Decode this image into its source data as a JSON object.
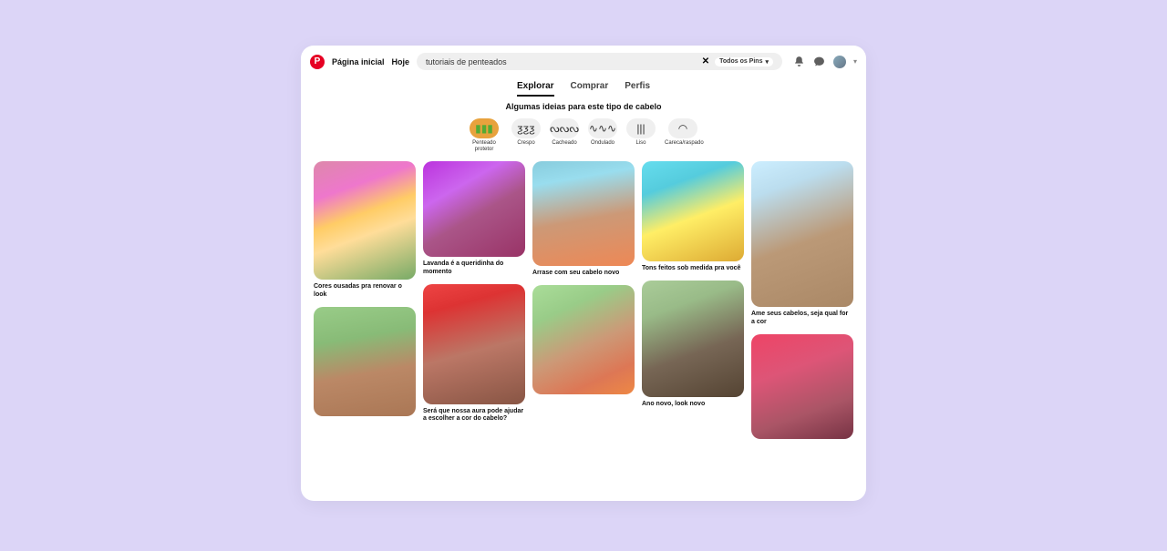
{
  "header": {
    "nav_home": "Página inicial",
    "nav_today": "Hoje",
    "search_value": "tutoriais de penteados",
    "search_pill": "Todos os Pins",
    "clear": "✕"
  },
  "tabs": [
    {
      "label": "Explorar",
      "active": true
    },
    {
      "label": "Comprar",
      "active": false
    },
    {
      "label": "Perfis",
      "active": false
    }
  ],
  "subtitle": "Algumas ideias para este tipo de cabelo",
  "filters": [
    {
      "label": "Penteado protetor",
      "glyph": "▮▮▮",
      "active": true
    },
    {
      "label": "Crespo",
      "glyph": "ƺƺƺ",
      "active": false
    },
    {
      "label": "Cacheado",
      "glyph": "ᔓᔓᔓ",
      "active": false
    },
    {
      "label": "Ondulado",
      "glyph": "∿∿∿",
      "active": false
    },
    {
      "label": "Liso",
      "glyph": "|||",
      "active": false
    },
    {
      "label": "Careca/raspado",
      "glyph": "◠",
      "active": false
    }
  ],
  "pins": [
    {
      "title": "Cores ousadas pra renovar o look"
    },
    {
      "title": ""
    },
    {
      "title": "Lavanda é a queridinha do momento"
    },
    {
      "title": "Será que nossa aura pode ajudar a escolher a cor do cabelo?"
    },
    {
      "title": "Arrase com seu cabelo novo"
    },
    {
      "title": ""
    },
    {
      "title": "Tons feitos sob medida pra você"
    },
    {
      "title": "Ano novo, look novo"
    },
    {
      "title": "Ame seus cabelos, seja qual for a cor"
    },
    {
      "title": ""
    }
  ]
}
